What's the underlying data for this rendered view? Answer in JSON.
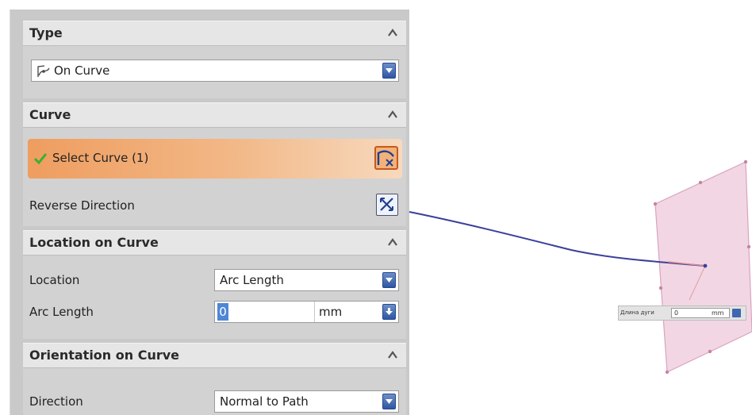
{
  "type_section": {
    "title": "Type",
    "selected": "On Curve"
  },
  "curve_section": {
    "title": "Curve",
    "select_label": "Select Curve (1)",
    "reverse_label": "Reverse Direction"
  },
  "location_section": {
    "title": "Location on Curve",
    "location_label": "Location",
    "location_value": "Arc Length",
    "arc_length_label": "Arc Length",
    "arc_length_value": "0",
    "arc_length_unit": "mm"
  },
  "orientation_section": {
    "title": "Orientation on Curve",
    "direction_label": "Direction",
    "direction_value": "Normal to Path"
  },
  "viewport": {
    "input_label": "Длина дуги",
    "input_value": "0",
    "input_unit": "mm"
  },
  "colors": {
    "accent_orange": "#f0a86c",
    "dropdown_blue": "#3f66b0",
    "curve_blue": "#3b3f9b",
    "plane_pink": "#f2d6e4"
  }
}
